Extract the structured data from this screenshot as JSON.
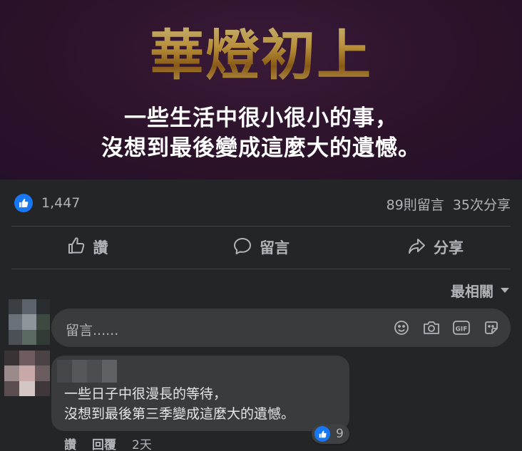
{
  "banner": {
    "title": "華燈初上",
    "line1": "一些生活中很小很小的事，",
    "line2": "沒想到最後變成這麼大的遺憾。"
  },
  "stats": {
    "like_icon": "thumbs-up-icon",
    "like_count": "1,447",
    "comments": "89則留言",
    "shares": "35次分享"
  },
  "actions": {
    "like": "讚",
    "comment": "留言",
    "share": "分享"
  },
  "sort": {
    "label": "最相關"
  },
  "composer": {
    "placeholder": "留言......",
    "icons": [
      "smiley-icon",
      "camera-icon",
      "gif-icon",
      "sticker-icon"
    ]
  },
  "comment": {
    "line1": "一些日子中很漫長的等待，",
    "line2": "沒想到最後第三季變成這麼大的遺憾。",
    "reaction_count": "9",
    "like_label": "讚",
    "reply_label": "回覆",
    "time": "2天"
  },
  "colors": {
    "accent": "#1877f2",
    "background": "#242526",
    "bubble": "#3a3b3c",
    "banner": "#2b1229",
    "gold": "#e2b857"
  }
}
